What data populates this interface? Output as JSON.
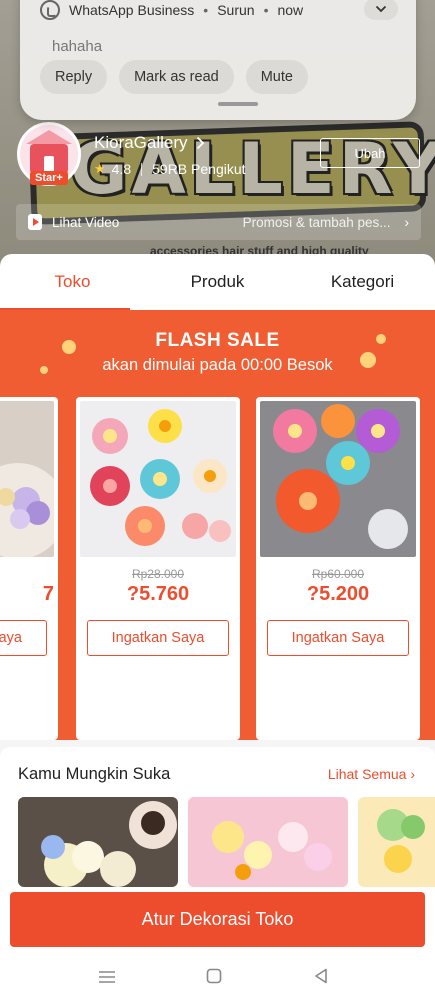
{
  "notification": {
    "app": "WhatsApp Business",
    "sender": "Surun",
    "time": "now",
    "message": "hahaha",
    "actions": [
      "Reply",
      "Mark as read",
      "Mute"
    ]
  },
  "banner": {
    "art_text": "GALLERY"
  },
  "shop": {
    "name": "KioraGallery",
    "badge": "Star+",
    "rating": "4.8",
    "followers": "59RB Pengikut",
    "change_button": "Ubah",
    "video_label": "Lihat Video",
    "promo_text": "Promosi & tambah pes...",
    "description_peek": "accessories hair stuff and high quality"
  },
  "tabs": [
    {
      "label": "Toko",
      "active": true
    },
    {
      "label": "Produk",
      "active": false
    },
    {
      "label": "Kategori",
      "active": false
    }
  ],
  "flash_sale": {
    "title": "FLASH SALE",
    "subtitle": "akan dimulai pada 00:00 Besok",
    "products": [
      {
        "price_old": "",
        "price_new": "7",
        "button": "Saya"
      },
      {
        "price_old": "Rp28.000",
        "price_new": "?5.760",
        "button": "Ingatkan Saya"
      },
      {
        "price_old": "Rp60.000",
        "price_new": "?5.200",
        "button": "Ingatkan Saya"
      }
    ]
  },
  "recommendations": {
    "title": "Kamu Mungkin Suka",
    "see_all": "Lihat Semua"
  },
  "bottom_button": "Atur Dekorasi Toko",
  "colors": {
    "accent": "#ee4d2d",
    "flash_bg": "#f05d32",
    "notification_bg": "#ecebe9"
  }
}
